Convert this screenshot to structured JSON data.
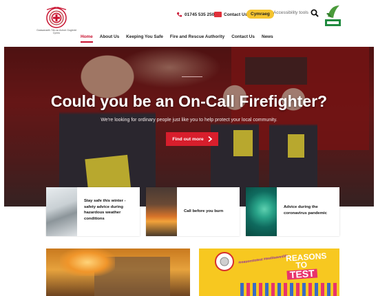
{
  "header": {
    "crest_caption": "Gwasanaeth Tân ac Achub Gogledd Cymru",
    "phone": "01745 535 250",
    "contact_label": "Contact Us",
    "language_toggle": "Cymraeg",
    "accessibility_label": "Accessibility tools"
  },
  "nav": {
    "items": [
      "Home",
      "About Us",
      "Keeping You Safe",
      "Fire and Rescue Authority",
      "Contact Us",
      "News"
    ],
    "active_index": 0
  },
  "hero": {
    "title": "Could you be an On-Call Firefighter?",
    "subtitle": "We're looking for ordinary people just like you to help protect your local community.",
    "cta_label": "Find out more",
    "cta_icon": "chevron-right-icon"
  },
  "cards": [
    {
      "text": "Stay safe this winter - safety advice during hazardous weather conditions",
      "image": "snow-road"
    },
    {
      "text": "Call before you burn",
      "image": "field-fire"
    },
    {
      "text": "Advice during the coronavirus pandemic",
      "image": "virus"
    }
  ],
  "promos": {
    "left_image": "burning-building",
    "right": {
      "hashtag": "#reasonstotest #testitsaveslife",
      "heading": "REASONS",
      "heading_2": "TO",
      "heading_3": "TEST"
    }
  },
  "colors": {
    "brand_red": "#c8102e",
    "cta_red": "#d81e2c",
    "cymraeg_yellow": "#f5c430",
    "enviro_green": "#1f8a3e"
  }
}
